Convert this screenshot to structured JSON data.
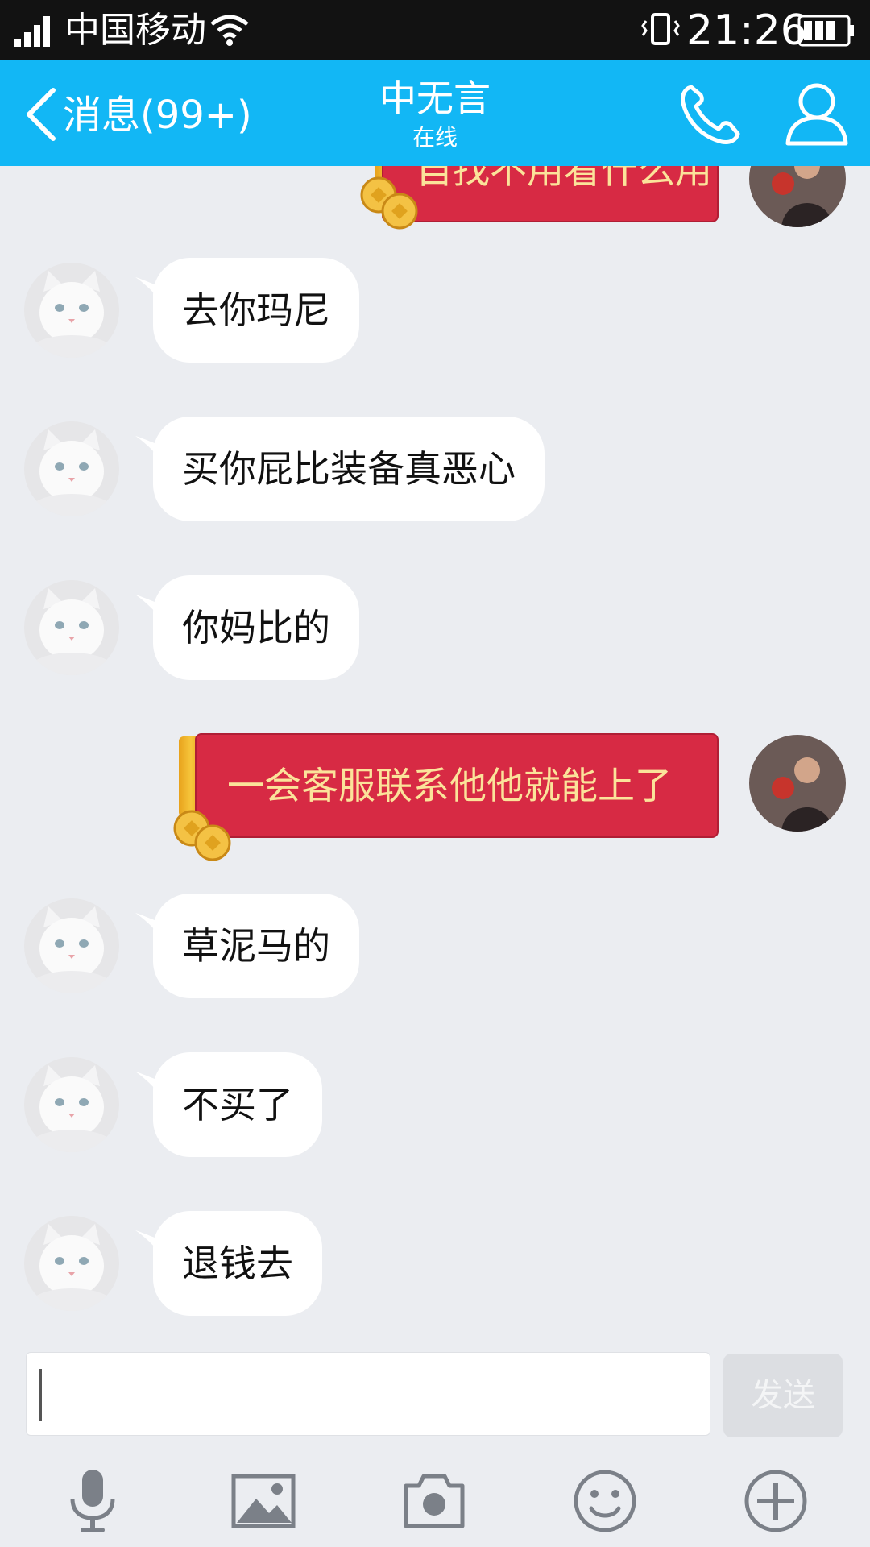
{
  "status_bar": {
    "carrier": "中国移动",
    "time": "21:26"
  },
  "header": {
    "back_label": "消息(99+)",
    "title": "中无言",
    "subtitle": "在线"
  },
  "messages": [
    {
      "side": "right",
      "type": "red_packet",
      "text": "自找不用看什么用"
    },
    {
      "side": "left",
      "type": "text",
      "text": "去你玛尼"
    },
    {
      "side": "left",
      "type": "text",
      "text": "买你屁比装备真恶心"
    },
    {
      "side": "left",
      "type": "text",
      "text": "你妈比的"
    },
    {
      "side": "right",
      "type": "red_packet",
      "text": "一会客服联系他他就能上了"
    },
    {
      "side": "left",
      "type": "text",
      "text": "草泥马的"
    },
    {
      "side": "left",
      "type": "text",
      "text": "不买了"
    },
    {
      "side": "left",
      "type": "text",
      "text": "退钱去"
    }
  ],
  "input": {
    "value": "",
    "send_label": "发送"
  },
  "toolbar": {
    "items": [
      "microphone-icon",
      "image-icon",
      "camera-icon",
      "emoji-icon",
      "plus-icon"
    ]
  },
  "colors": {
    "header": "#12b7f5",
    "background": "#ebedf1",
    "red_packet": "#d72a44",
    "red_packet_text": "#fbe39a"
  }
}
